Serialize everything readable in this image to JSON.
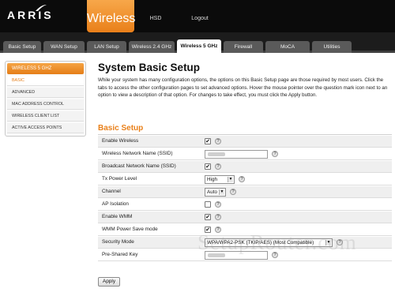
{
  "header": {
    "logo_text": "ARRIS",
    "nav": [
      {
        "label": "Wireless",
        "active": true
      },
      {
        "label": "HSD",
        "active": false
      },
      {
        "label": "Logout",
        "active": false
      }
    ]
  },
  "tabs": [
    {
      "label": "Basic Setup",
      "active": false
    },
    {
      "label": "WAN Setup",
      "active": false
    },
    {
      "label": "LAN Setup",
      "active": false
    },
    {
      "label": "Wireless 2.4 GHz",
      "active": false
    },
    {
      "label": "Wireless 5 GHz",
      "active": true
    },
    {
      "label": "Firewall",
      "active": false
    },
    {
      "label": "MoCA",
      "active": false
    },
    {
      "label": "Utilities",
      "active": false
    }
  ],
  "sidebar": {
    "title": "WIRELESS 5 GHZ",
    "items": [
      {
        "label": "BASIC",
        "active": true
      },
      {
        "label": "ADVANCED",
        "active": false
      },
      {
        "label": "MAC ADDRESS CONTROL",
        "active": false
      },
      {
        "label": "WIRELESS CLIENT LIST",
        "active": false
      },
      {
        "label": "ACTIVE ACCESS POINTS",
        "active": false
      }
    ]
  },
  "main": {
    "title": "System Basic Setup",
    "intro": "While your system has many configuration options, the options on this Basic Setup page are those required by most users. Click the tabs to access the other configuration pages to set advanced options. Hover the mouse pointer over the question mark icon next to an option to view a description of that option. For changes to take effect, you must click the Apply button.",
    "section_title": "Basic Setup",
    "fields": {
      "enable_wireless": {
        "label": "Enable Wireless",
        "checked": true
      },
      "ssid": {
        "label": "Wireless Network Name (SSID)",
        "value": ""
      },
      "broadcast_ssid": {
        "label": "Broadcast Network Name (SSID)",
        "checked": true
      },
      "tx_power": {
        "label": "Tx Power Level",
        "value": "High"
      },
      "channel": {
        "label": "Channel",
        "value": "Auto"
      },
      "ap_isolation": {
        "label": "AP Isolation",
        "checked": false
      },
      "enable_wmm": {
        "label": "Enable WMM",
        "checked": true
      },
      "wmm_power_save": {
        "label": "WMM Power Save mode",
        "checked": true
      },
      "security_mode": {
        "label": "Security Mode",
        "value": "WPA/WPA2-PSK (TKIP/AES) (Most Compatible)"
      },
      "psk": {
        "label": "Pre-Shared Key",
        "value": ""
      }
    },
    "apply_label": "Apply",
    "help_glyph": "?",
    "check_glyph": "✔"
  },
  "watermark": "SetupRouter.com",
  "colors": {
    "accent": "#e9801a",
    "header_bg": "#0b0b0b",
    "tab_bg": "#5a5a5a"
  }
}
